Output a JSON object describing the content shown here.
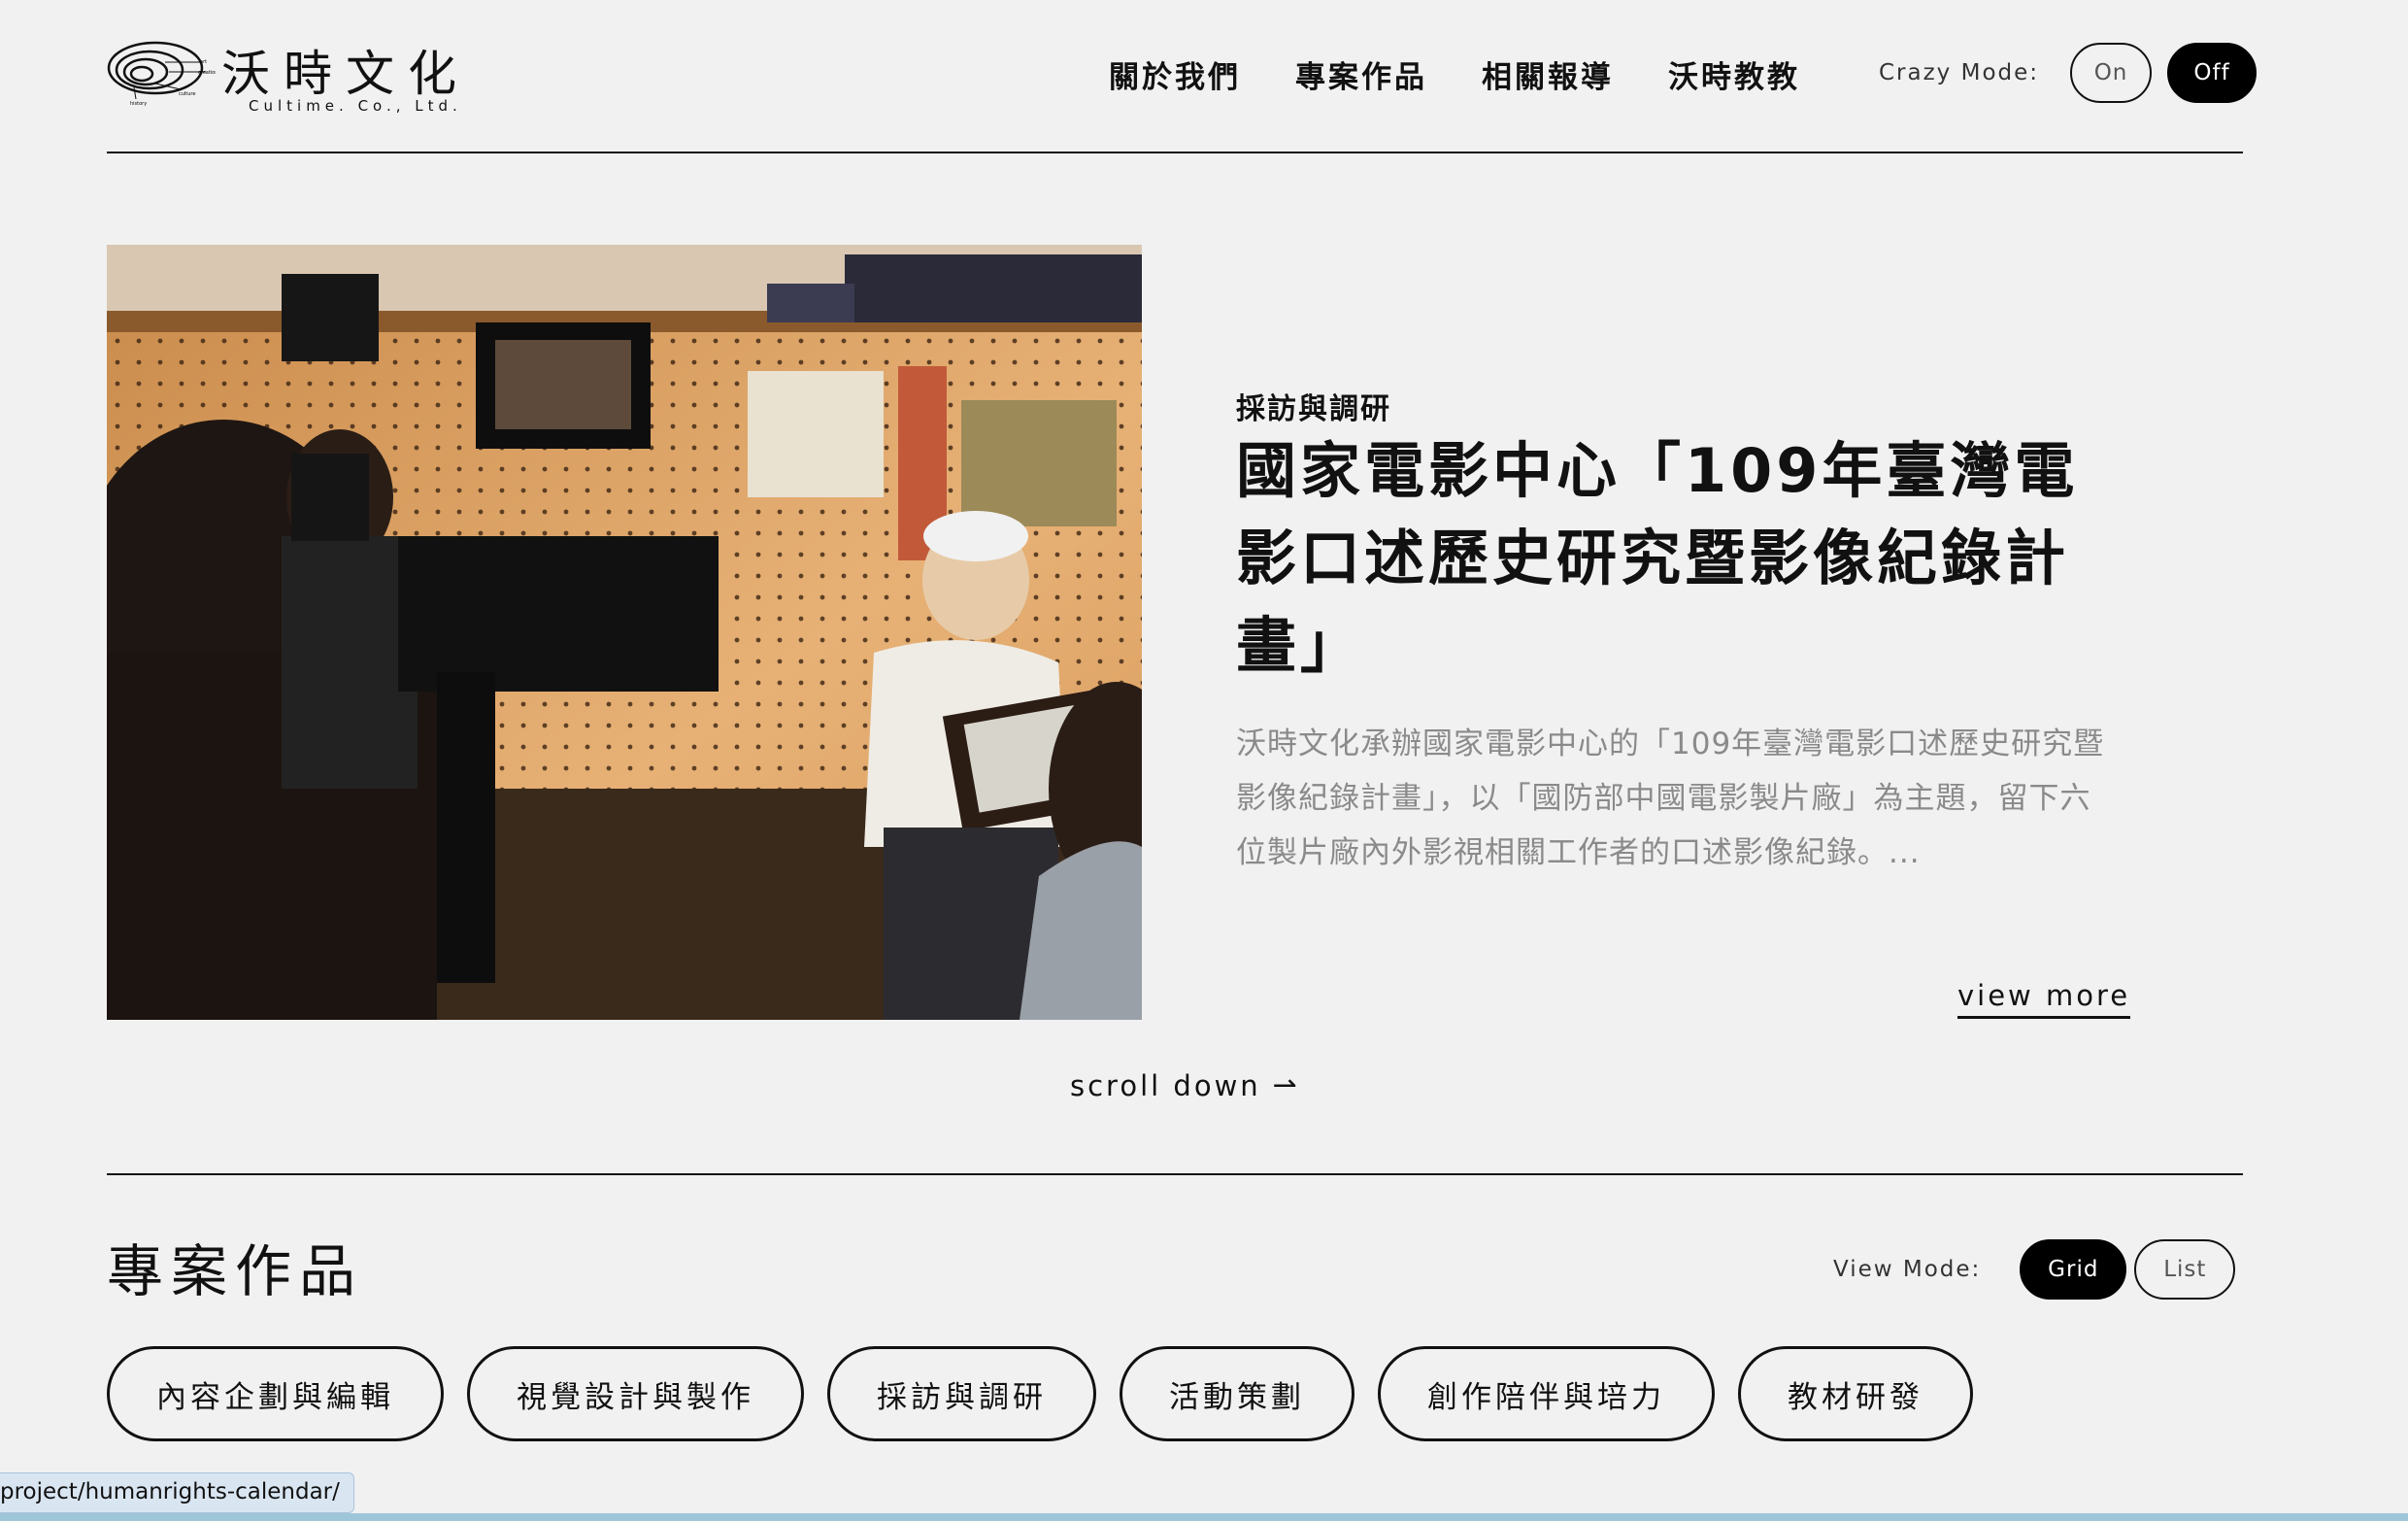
{
  "header": {
    "logo": {
      "name": "沃時文化",
      "subtitle": "Cultime. Co., Ltd.",
      "mark_words": [
        "art",
        "creation",
        "culture",
        "history"
      ]
    },
    "nav": [
      {
        "label": "關於我們"
      },
      {
        "label": "專案作品"
      },
      {
        "label": "相關報導"
      },
      {
        "label": "沃時教教"
      }
    ],
    "crazy_mode": {
      "label": "Crazy Mode:",
      "on": "On",
      "off": "Off",
      "selected": "Off"
    }
  },
  "hero": {
    "category": "採訪與調研",
    "title": "國家電影中心「109年臺灣電影口述歷史研究暨影像紀錄計畫」",
    "description": "沃時文化承辦國家電影中心的「109年臺灣電影口述歷史研究暨影像紀錄計畫」，以「國防部中國電影製片廠」為主題，留下六位製片廠內外影視相關工作者的口述影像紀錄。...",
    "view_more": "view more",
    "scroll_down": "scroll down"
  },
  "projects": {
    "title": "專案作品",
    "view_mode": {
      "label": "View Mode:",
      "grid": "Grid",
      "list": "List",
      "selected": "Grid"
    },
    "filters": [
      {
        "label": "內容企劃與編輯"
      },
      {
        "label": "視覺設計與製作"
      },
      {
        "label": "採訪與調研"
      },
      {
        "label": "活動策劃"
      },
      {
        "label": "創作陪伴與培力"
      },
      {
        "label": "教材研發"
      }
    ]
  },
  "status_bar": {
    "url": "project/humanrights-calendar/"
  },
  "colors": {
    "background": "#f1f1f1",
    "text": "#111111",
    "muted": "#8a8a8a",
    "status_bg": "#d9e6f2",
    "bottom_bar": "#9fc6d8"
  }
}
